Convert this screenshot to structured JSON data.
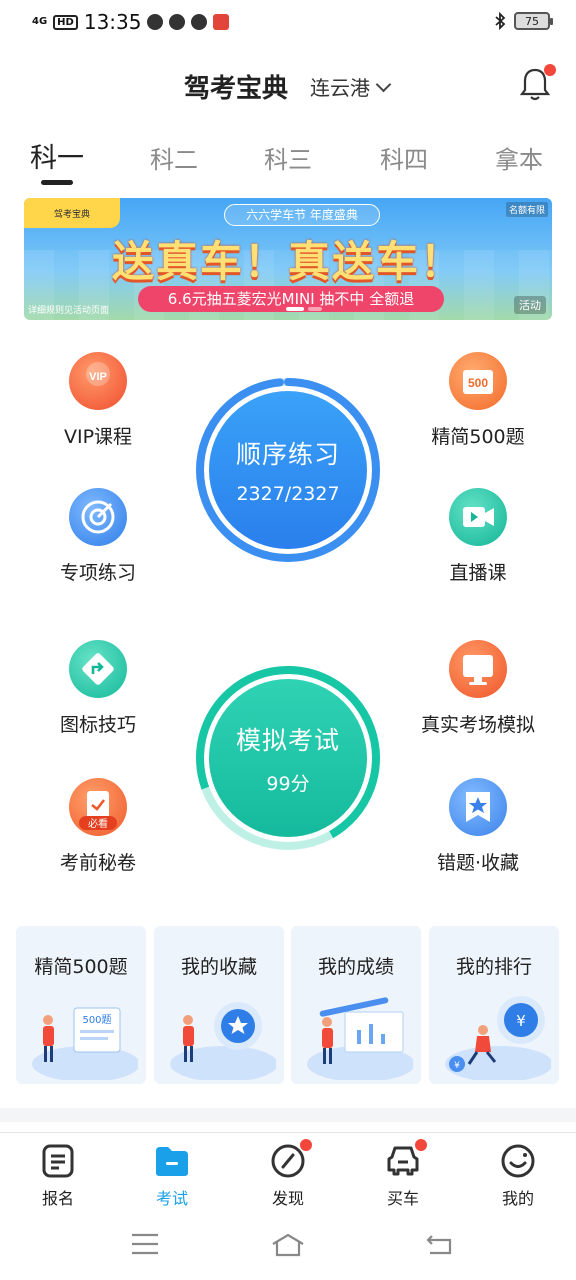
{
  "status_bar": {
    "network": "4G",
    "hd": "HD",
    "time": "13:35",
    "battery": "75"
  },
  "header": {
    "title": "驾考宝典",
    "city": "连云港"
  },
  "subject_tabs": [
    "科一",
    "科二",
    "科三",
    "科四",
    "拿本"
  ],
  "banner": {
    "tagline": "六六学车节 年度盛典",
    "headline": "送真车！真送车！",
    "subline": "6.6元抽五菱宏光MINI 抽不中 全额退",
    "corner_note": "名额有限",
    "rules_note": "详细规则见活动页面",
    "tag": "活动",
    "logo": "驾考宝典"
  },
  "features_left": [
    {
      "label": "VIP课程",
      "icon": "vip-icon",
      "color": "#f2603a"
    },
    {
      "label": "专项练习",
      "icon": "target-icon",
      "color": "#3f8ef0"
    },
    {
      "label": "图标技巧",
      "icon": "road-sign-icon",
      "color": "#1fc4a8"
    },
    {
      "label": "考前秘卷",
      "icon": "clipboard-icon",
      "color": "#f27a3a",
      "badge": "必看"
    }
  ],
  "features_right": [
    {
      "label": "精简500题",
      "icon": "500-icon",
      "color": "#f47d3a",
      "badge": "500"
    },
    {
      "label": "直播课",
      "icon": "video-icon",
      "color": "#18c1a6"
    },
    {
      "label": "真实考场模拟",
      "icon": "monitor-icon",
      "color": "#f36a3a"
    },
    {
      "label": "错题·收藏",
      "icon": "bookmark-star-icon",
      "color": "#3f8ef0"
    }
  ],
  "practice": {
    "title": "顺序练习",
    "progress": "2327/2327",
    "progress_fraction": 1.0
  },
  "exam": {
    "title": "模拟考试",
    "score": "99分"
  },
  "cards": [
    {
      "title": "精简500题",
      "illu_text": "500题"
    },
    {
      "title": "我的收藏"
    },
    {
      "title": "我的成绩"
    },
    {
      "title": "我的排行"
    }
  ],
  "bottom_nav": [
    {
      "label": "报名",
      "icon": "form-icon"
    },
    {
      "label": "考试",
      "icon": "folder-icon",
      "active": true
    },
    {
      "label": "发现",
      "icon": "compass-icon",
      "dot": true
    },
    {
      "label": "买车",
      "icon": "car-icon",
      "dot": true
    },
    {
      "label": "我的",
      "icon": "smile-icon"
    }
  ],
  "colors": {
    "accent": "#1aa0e8",
    "practice_blue": "#2f8cf0",
    "exam_green": "#1dc8a8",
    "notify_red": "#f2473a"
  }
}
